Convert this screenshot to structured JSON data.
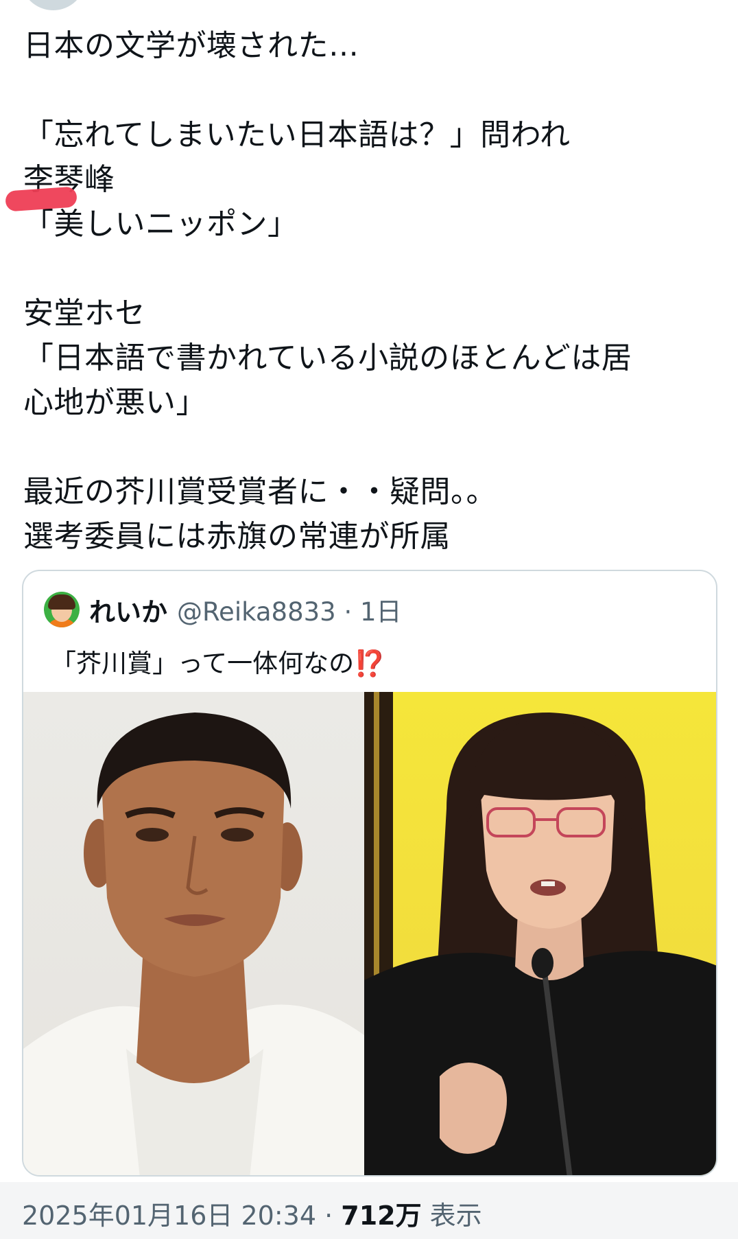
{
  "post": {
    "lines": [
      "日本の文学が壊された…",
      "",
      "「忘れてしまいたい日本語は？」問われ",
      "李琴峰",
      "「美しいニッポン」",
      "",
      "安堂ホセ",
      "「日本語で書かれている小説のほとんどは居",
      "心地が悪い」",
      "",
      "最近の芥川賞受賞者に・・疑問。。",
      "選考委員には赤旗の常連が所属"
    ]
  },
  "quote": {
    "name": "れいか",
    "handle": "@Reika8833 · 1日",
    "text": "「芥川賞」って一体何なの",
    "text_emoji": "⁉️",
    "accent_color": "#e814c8",
    "images": [
      "portrait-photo-man",
      "portrait-photo-woman-at-microphone"
    ]
  },
  "meta": {
    "timestamp": "2025年01月16日 20:34 · ",
    "views_count": "712万",
    "views_label": " 表示"
  },
  "colors": {
    "text": "#0f1419",
    "secondary": "#536471",
    "border": "#cfd9de",
    "highlight_mark": "#ee3e55"
  }
}
